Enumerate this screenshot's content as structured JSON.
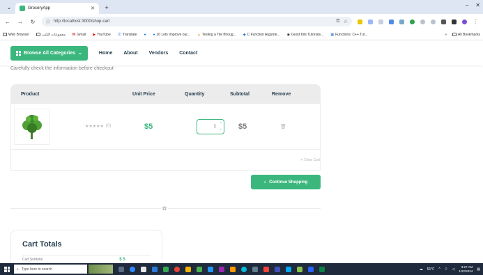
{
  "browser": {
    "tab_title": "GroceryApp",
    "url": "http://localhost:3000/shop-cart",
    "bookmarks": [
      "Web Browser",
      "مجموعات الكتب",
      "Gmail",
      "YouTube",
      "Translate",
      "",
      "10 Lets Improve our...",
      "Testing a Tile throug...",
      "C Function Argume...",
      "Good Kits Tutorials...",
      "Functions: C++ Tut..."
    ],
    "all_bookmarks_label": "All Bookmarks"
  },
  "site": {
    "browse_button": "Browse All Categories",
    "menu": [
      "Home",
      "About",
      "Vendors",
      "Contact"
    ]
  },
  "cart": {
    "notice": "Carefully check the information before checkout",
    "headers": {
      "product": "Product",
      "unit_price": "Unit Price",
      "quantity": "Quantity",
      "subtotal": "Subtotal",
      "remove": "Remove"
    },
    "item": {
      "rating_count": "(0)",
      "price": "$5",
      "quantity": "1",
      "subtotal": "$5"
    },
    "clear_cart": "Clear Cart",
    "continue_button": "Continue Shopping"
  },
  "totals": {
    "title": "Cart Totals",
    "subtotal_label": "Cart Subtotal",
    "subtotal_value": "$ 5"
  },
  "taskbar": {
    "search_placeholder": "Type here to search",
    "weather": "51°F",
    "time": "3:27 AM",
    "date": "1/22/2024"
  },
  "colors": {
    "accent": "#3bb77e",
    "heading": "#253d4e",
    "muted": "#7e7e7e"
  }
}
